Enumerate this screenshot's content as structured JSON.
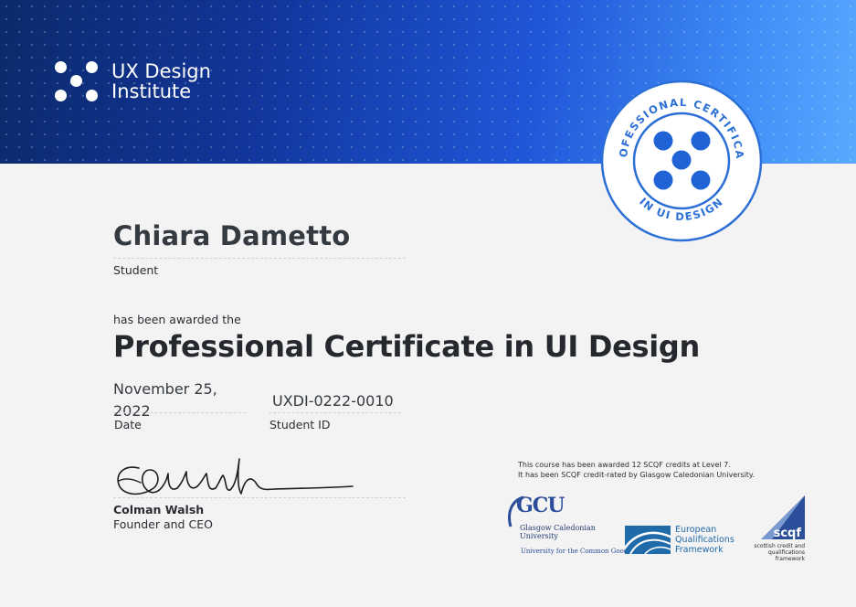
{
  "brand": {
    "line1": "UX Design",
    "line2": "Institute",
    "colors": {
      "banner_dark": "#0b2a6b",
      "banner_light": "#5aa9ff",
      "accent": "#1f56d8"
    }
  },
  "seal": {
    "top_text": "PROFESSIONAL CERTIFICATE",
    "bottom_text": "IN UI DESIGN"
  },
  "recipient": {
    "name": "Chiara Dametto",
    "role_label": "Student"
  },
  "award": {
    "intro": "has been awarded the",
    "title": "Professional Certificate in UI Design"
  },
  "details": {
    "date_value": "November 25, 2022",
    "date_label": "Date",
    "student_id_value": "UXDI-0222-0010",
    "student_id_label": "Student ID"
  },
  "signatory": {
    "name": "Colman Walsh",
    "title": "Founder and CEO"
  },
  "accreditation": {
    "line1": "This course has been awarded 12 SCQF credits at Level 7.",
    "line2": "It has been SCQF credit-rated by Glasgow Caledonian University.",
    "gcu": {
      "abbr": "GCU",
      "name_line1": "Glasgow Caledonian",
      "name_line2": "University",
      "tagline": "University for the Common Good"
    },
    "eqf": {
      "line1": "European",
      "line2": "Qualifications",
      "line3": "Framework"
    },
    "scqf": {
      "abbr": "scqf",
      "line1": "scottish credit and",
      "line2": "qualifications framework"
    }
  }
}
